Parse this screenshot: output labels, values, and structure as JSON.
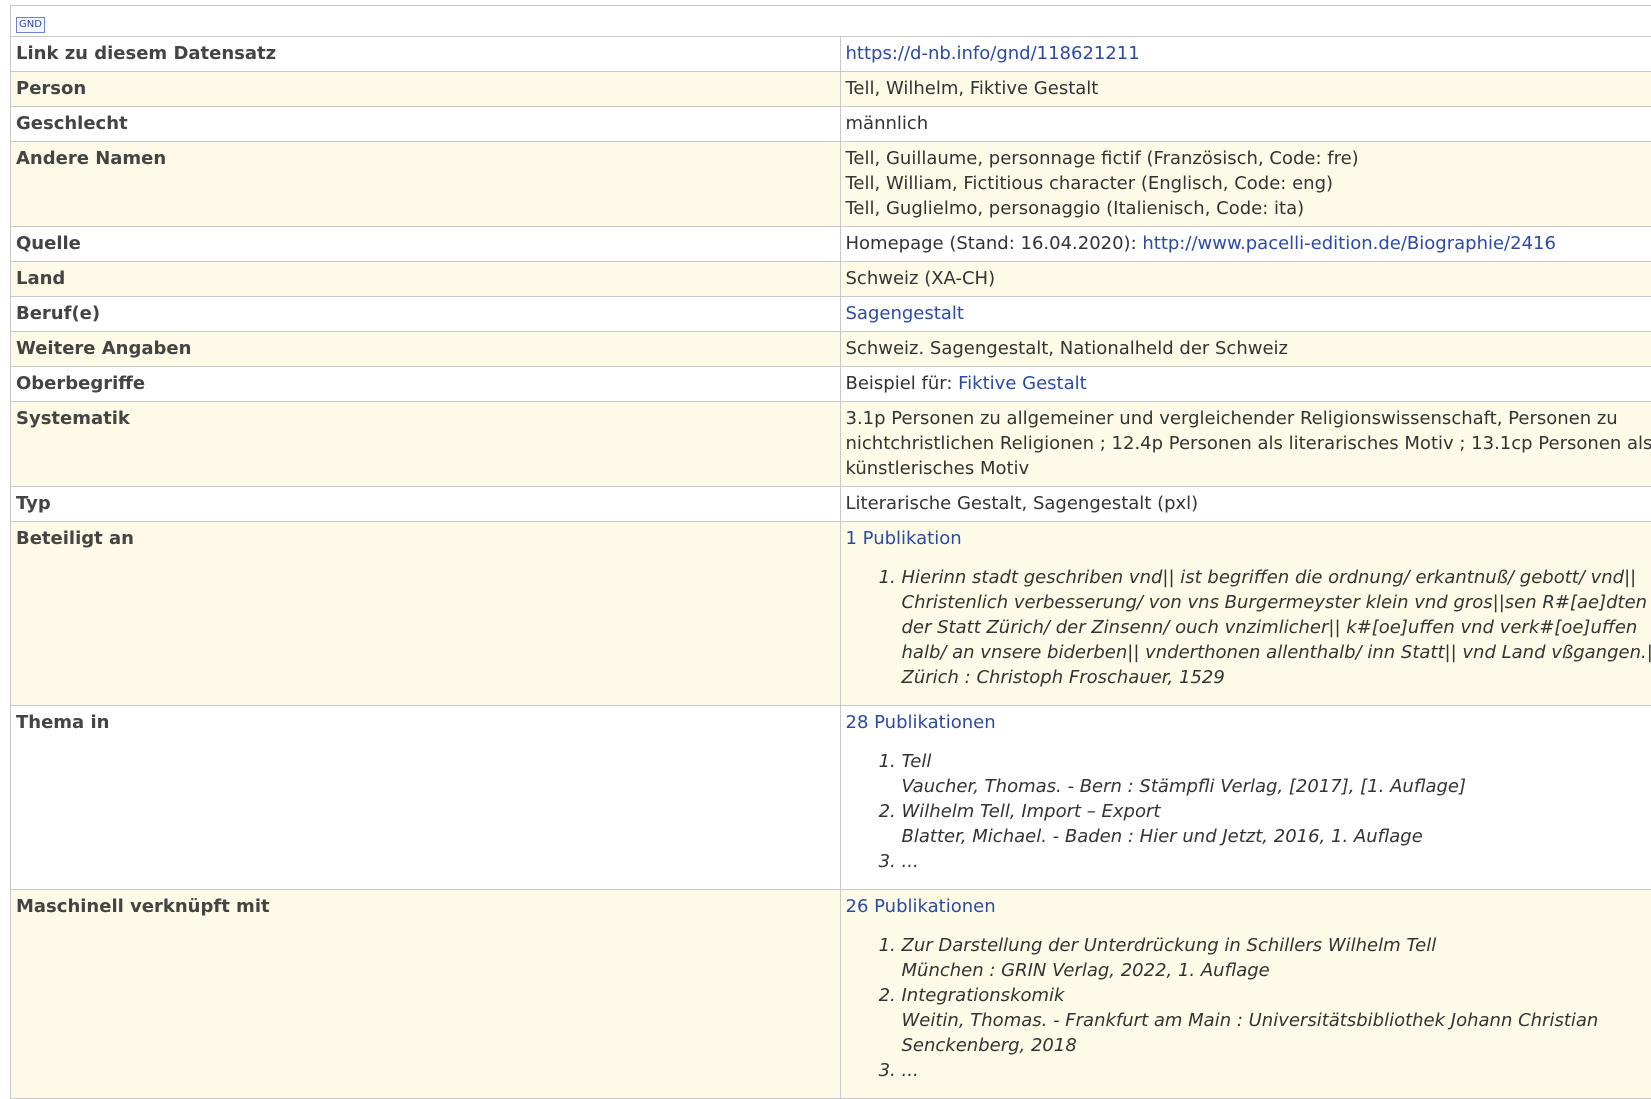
{
  "header": {
    "badge": "GND"
  },
  "rows": {
    "link": {
      "label": "Link zu diesem Datensatz",
      "url": "https://d-nb.info/gnd/118621211"
    },
    "person": {
      "label": "Person",
      "value": "Tell, Wilhelm, Fiktive Gestalt"
    },
    "geschlecht": {
      "label": "Geschlecht",
      "value": "männlich"
    },
    "andere_namen": {
      "label": "Andere Namen",
      "values": [
        "Tell, Guillaume, personnage fictif (Französisch, Code: fre)",
        "Tell, William, Fictitious character (Englisch, Code: eng)",
        "Tell, Guglielmo, personaggio (Italienisch, Code: ita)"
      ]
    },
    "quelle": {
      "label": "Quelle",
      "prefix": "Homepage (Stand: 16.04.2020): ",
      "url": "http://www.pacelli-edition.de/Biographie/2416"
    },
    "land": {
      "label": "Land",
      "value": "Schweiz (XA-CH)"
    },
    "berufe": {
      "label": "Beruf(e)",
      "link": "Sagengestalt"
    },
    "weitere": {
      "label": "Weitere Angaben",
      "value": "Schweiz. Sagengestalt, Nationalheld der Schweiz"
    },
    "oberbegriffe": {
      "label": "Oberbegriffe",
      "prefix": "Beispiel für: ",
      "link": "Fiktive Gestalt"
    },
    "systematik": {
      "label": "Systematik",
      "value": "3.1p Personen zu allgemeiner und vergleichender Religionswissenschaft, Personen zu nichtchristlichen Religionen ; 12.4p Personen als literarisches Motiv ; 13.1cp Personen als künstlerisches Motiv"
    },
    "typ": {
      "label": "Typ",
      "value": "Literarische Gestalt, Sagengestalt (pxl)"
    },
    "beteiligt": {
      "label": "Beteiligt an",
      "count_link": "1 Publikation",
      "items": [
        {
          "title": "Hierinn stadt geschriben vnd|| ist begriffen die ordnung/ erkantnuß/ gebott/ vnd|| Christenlich verbesserung/ von vns Burgermeyster klein vnd gros||sen R#[ae]dten der Statt Zürich/ der Zinsenn/ ouch vnzimlicher|| k#[oe]uffen vnd verk#[oe]uffen halb/ an vnsere biderben|| vnderthonen allenthalb/ inn Statt|| vnd Land vßgangen.||",
          "meta": "Zürich : Christoph Froschauer, 1529"
        }
      ]
    },
    "thema": {
      "label": "Thema in",
      "count_link": "28 Publikationen",
      "items": [
        {
          "title": "Tell",
          "meta": "Vaucher, Thomas. - Bern : Stämpfli Verlag, [2017], [1. Auflage]"
        },
        {
          "title": "Wilhelm Tell, Import – Export",
          "meta": "Blatter, Michael. - Baden : Hier und Jetzt, 2016, 1. Auflage"
        },
        {
          "title": "...",
          "meta": ""
        }
      ]
    },
    "maschinell": {
      "label": "Maschinell verknüpft mit",
      "count_link": "26 Publikationen",
      "items": [
        {
          "title": "Zur Darstellung der Unterdrückung in Schillers Wilhelm Tell",
          "meta": "München : GRIN Verlag, 2022, 1. Auflage"
        },
        {
          "title": "Integrationskomik",
          "meta": "Weitin, Thomas. - Frankfurt am Main : Universitätsbibliothek Johann Christian Senckenberg, 2018"
        },
        {
          "title": "...",
          "meta": ""
        }
      ]
    }
  }
}
